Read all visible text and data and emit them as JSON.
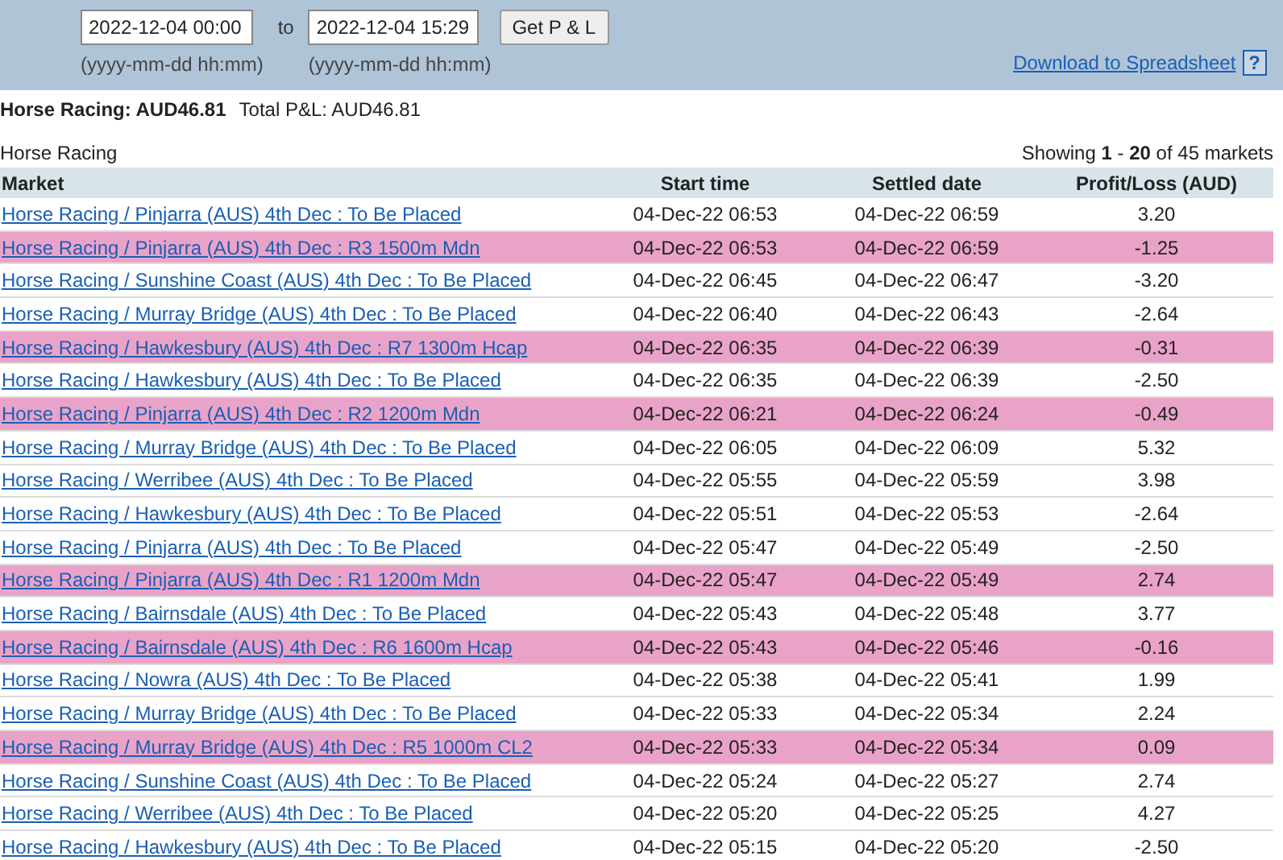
{
  "filter": {
    "from": "2022-12-04 00:00",
    "to_label": "to",
    "to": "2022-12-04 15:29",
    "from_hint": "(yyyy-mm-dd hh:mm)",
    "to_hint": "(yyyy-mm-dd hh:mm)",
    "button": "Get P & L",
    "download": "Download to Spreadsheet",
    "help": "?"
  },
  "summary": {
    "title": "Horse Racing: AUD46.81",
    "total": "Total P&L: AUD46.81"
  },
  "section": "Horse Racing",
  "showing": "Showing **1** - **20** of 45 markets",
  "table": {
    "columns": [
      "Market",
      "Start time",
      "Settled date",
      "Profit/Loss (AUD)"
    ],
    "rows": [
      {
        "market": "Horse Racing / Pinjarra (AUS) 4th Dec : To Be Placed",
        "start": "04-Dec-22 06:53",
        "settled": "04-Dec-22 06:59",
        "pl": "3.20",
        "highlighted": false
      },
      {
        "market": "Horse Racing / Pinjarra (AUS) 4th Dec : R3 1500m Mdn",
        "start": "04-Dec-22 06:53",
        "settled": "04-Dec-22 06:59",
        "pl": "-1.25",
        "highlighted": true
      },
      {
        "market": "Horse Racing / Sunshine Coast (AUS) 4th Dec : To Be Placed",
        "start": "04-Dec-22 06:45",
        "settled": "04-Dec-22 06:47",
        "pl": "-3.20",
        "highlighted": false
      },
      {
        "market": "Horse Racing / Murray Bridge (AUS) 4th Dec : To Be Placed",
        "start": "04-Dec-22 06:40",
        "settled": "04-Dec-22 06:43",
        "pl": "-2.64",
        "highlighted": false
      },
      {
        "market": "Horse Racing / Hawkesbury (AUS) 4th Dec : R7 1300m Hcap",
        "start": "04-Dec-22 06:35",
        "settled": "04-Dec-22 06:39",
        "pl": "-0.31",
        "highlighted": true
      },
      {
        "market": "Horse Racing / Hawkesbury (AUS) 4th Dec : To Be Placed",
        "start": "04-Dec-22 06:35",
        "settled": "04-Dec-22 06:39",
        "pl": "-2.50",
        "highlighted": false
      },
      {
        "market": "Horse Racing / Pinjarra (AUS) 4th Dec : R2 1200m Mdn",
        "start": "04-Dec-22 06:21",
        "settled": "04-Dec-22 06:24",
        "pl": "-0.49",
        "highlighted": true
      },
      {
        "market": "Horse Racing / Murray Bridge (AUS) 4th Dec : To Be Placed",
        "start": "04-Dec-22 06:05",
        "settled": "04-Dec-22 06:09",
        "pl": "5.32",
        "highlighted": false
      },
      {
        "market": "Horse Racing / Werribee (AUS) 4th Dec : To Be Placed",
        "start": "04-Dec-22 05:55",
        "settled": "04-Dec-22 05:59",
        "pl": "3.98",
        "highlighted": false
      },
      {
        "market": "Horse Racing / Hawkesbury (AUS) 4th Dec : To Be Placed",
        "start": "04-Dec-22 05:51",
        "settled": "04-Dec-22 05:53",
        "pl": "-2.64",
        "highlighted": false
      },
      {
        "market": "Horse Racing / Pinjarra (AUS) 4th Dec : To Be Placed",
        "start": "04-Dec-22 05:47",
        "settled": "04-Dec-22 05:49",
        "pl": "-2.50",
        "highlighted": false
      },
      {
        "market": "Horse Racing / Pinjarra (AUS) 4th Dec : R1 1200m Mdn",
        "start": "04-Dec-22 05:47",
        "settled": "04-Dec-22 05:49",
        "pl": "2.74",
        "highlighted": true
      },
      {
        "market": "Horse Racing / Bairnsdale (AUS) 4th Dec : To Be Placed",
        "start": "04-Dec-22 05:43",
        "settled": "04-Dec-22 05:48",
        "pl": "3.77",
        "highlighted": false
      },
      {
        "market": "Horse Racing / Bairnsdale (AUS) 4th Dec : R6 1600m Hcap",
        "start": "04-Dec-22 05:43",
        "settled": "04-Dec-22 05:46",
        "pl": "-0.16",
        "highlighted": true
      },
      {
        "market": "Horse Racing / Nowra (AUS) 4th Dec : To Be Placed",
        "start": "04-Dec-22 05:38",
        "settled": "04-Dec-22 05:41",
        "pl": "1.99",
        "highlighted": false
      },
      {
        "market": "Horse Racing / Murray Bridge (AUS) 4th Dec : To Be Placed",
        "start": "04-Dec-22 05:33",
        "settled": "04-Dec-22 05:34",
        "pl": "2.24",
        "highlighted": false
      },
      {
        "market": "Horse Racing / Murray Bridge (AUS) 4th Dec : R5 1000m CL2",
        "start": "04-Dec-22 05:33",
        "settled": "04-Dec-22 05:34",
        "pl": "0.09",
        "highlighted": true
      },
      {
        "market": "Horse Racing / Sunshine Coast (AUS) 4th Dec : To Be Placed",
        "start": "04-Dec-22 05:24",
        "settled": "04-Dec-22 05:27",
        "pl": "2.74",
        "highlighted": false
      },
      {
        "market": "Horse Racing / Werribee (AUS) 4th Dec : To Be Placed",
        "start": "04-Dec-22 05:20",
        "settled": "04-Dec-22 05:25",
        "pl": "4.27",
        "highlighted": false
      },
      {
        "market": "Horse Racing / Hawkesbury (AUS) 4th Dec : To Be Placed",
        "start": "04-Dec-22 05:15",
        "settled": "04-Dec-22 05:20",
        "pl": "-2.50",
        "highlighted": false
      }
    ]
  }
}
